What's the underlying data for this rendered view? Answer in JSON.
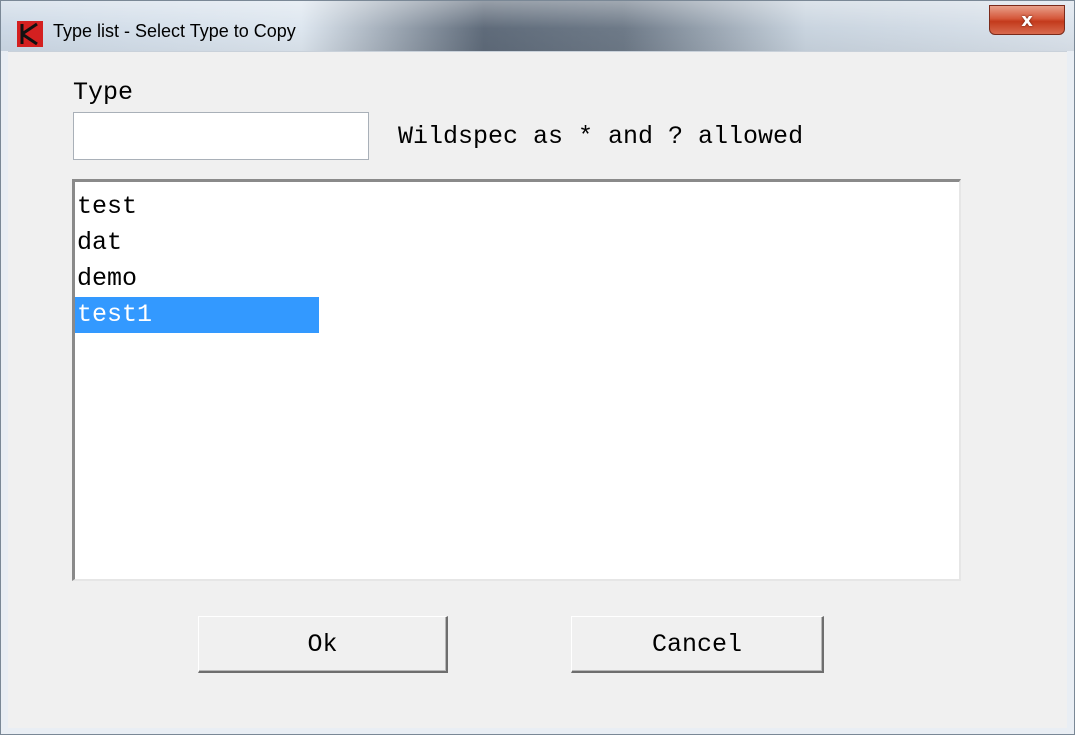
{
  "window": {
    "title": "Type list - Select Type to Copy",
    "close_glyph": "x",
    "app_icon": "app-logo-icon"
  },
  "filter": {
    "label": "Type",
    "value": "",
    "hint": "Wildspec as * and ? allowed"
  },
  "list": {
    "items": [
      "test",
      "dat",
      "demo",
      "test1"
    ],
    "selected_item": "test1"
  },
  "buttons": {
    "ok_label": "Ok",
    "cancel_label": "Cancel"
  },
  "colors": {
    "selection": "#3399ff",
    "close_button": "#c8452a",
    "app_icon": "#d42020"
  }
}
